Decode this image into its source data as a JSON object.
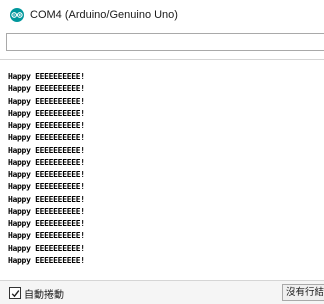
{
  "window": {
    "title": "COM4 (Arduino/Genuino Uno)",
    "icon": "arduino-logo-icon",
    "accent_color": "#00979c"
  },
  "send": {
    "value": "",
    "placeholder": ""
  },
  "output": {
    "lines": [
      "Happy EEEEEEEEEE!",
      "Happy EEEEEEEEEE!",
      "Happy EEEEEEEEEE!",
      "Happy EEEEEEEEEE!",
      "Happy EEEEEEEEEE!",
      "Happy EEEEEEEEEE!",
      "Happy EEEEEEEEEE!",
      "Happy EEEEEEEEEE!",
      "Happy EEEEEEEEEE!",
      "Happy EEEEEEEEEE!",
      "Happy EEEEEEEEEE!",
      "Happy EEEEEEEEEE!",
      "Happy EEEEEEEEEE!",
      "Happy EEEEEEEEEE!",
      "Happy EEEEEEEEEE!",
      "Happy EEEEEEEEEE!"
    ]
  },
  "footer": {
    "autoscroll_label": "自動捲動",
    "autoscroll_checked": true,
    "line_ending_value": "沒有行結尾"
  }
}
